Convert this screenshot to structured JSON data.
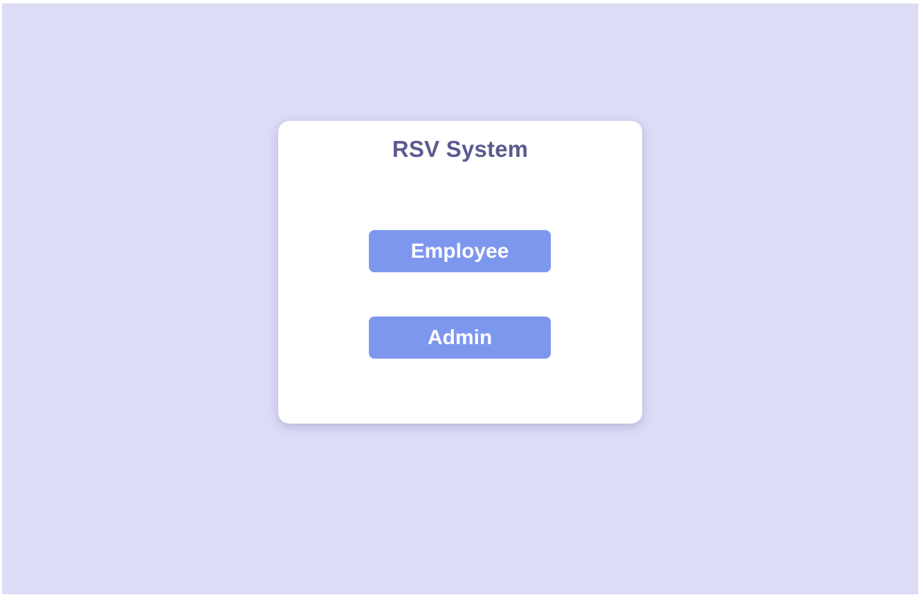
{
  "app": {
    "title": "RSV System"
  },
  "buttons": {
    "employee_label": "Employee",
    "admin_label": "Admin"
  },
  "colors": {
    "background": "#dcdcf7",
    "card": "#ffffff",
    "title": "#5b5a8f",
    "button": "#7e97ee",
    "button_text": "#ffffff"
  }
}
